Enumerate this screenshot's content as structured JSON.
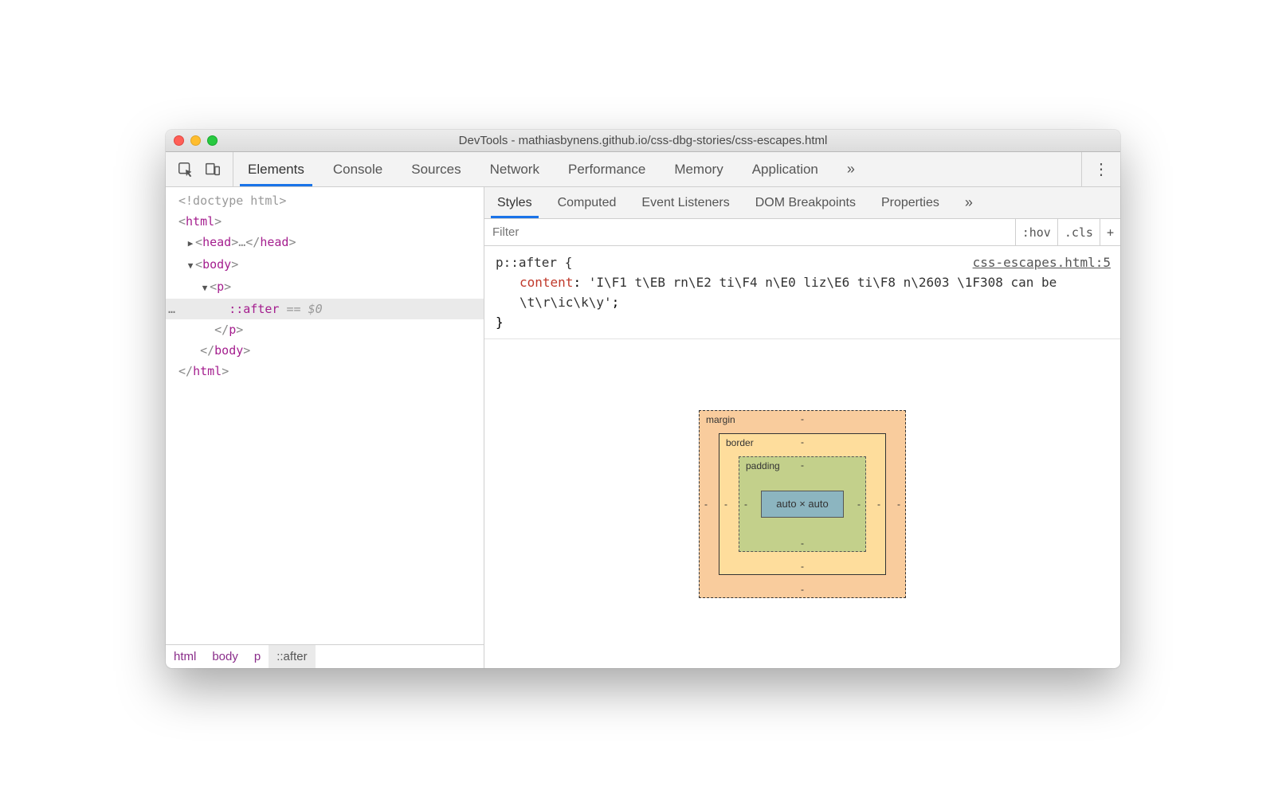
{
  "window": {
    "title": "DevTools - mathiasbynens.github.io/css-dbg-stories/css-escapes.html"
  },
  "main_tabs": {
    "items": [
      "Elements",
      "Console",
      "Sources",
      "Network",
      "Performance",
      "Memory",
      "Application"
    ],
    "overflow": "»",
    "active_index": 0
  },
  "dom": {
    "doctype": "<!doctype html>",
    "html_open": "html",
    "head_open": "head",
    "head_ellipsis": "…",
    "body_open": "body",
    "p_open": "p",
    "pseudo": "::after",
    "eq": " == ",
    "dollar": "$0",
    "p_close": "p",
    "body_close": "body",
    "html_close": "html"
  },
  "breadcrumbs": [
    "html",
    "body",
    "p",
    "::after"
  ],
  "sub_tabs": {
    "items": [
      "Styles",
      "Computed",
      "Event Listeners",
      "DOM Breakpoints",
      "Properties"
    ],
    "overflow": "»",
    "active_index": 0
  },
  "filter": {
    "placeholder": "Filter",
    "hov": ":hov",
    "cls": ".cls",
    "plus": "+"
  },
  "rule": {
    "selector": "p::after {",
    "source": "css-escapes.html:5",
    "prop": "content",
    "value": "'I\\F1 t\\EB rn\\E2 ti\\F4 n\\E0 liz\\E6 ti\\F8 n\\2603 \\1F308 can be \\t\\r\\ic\\k\\y'",
    "semi": ";",
    "close": "}"
  },
  "boxmodel": {
    "margin_label": "margin",
    "border_label": "border",
    "padding_label": "padding",
    "dash": "-",
    "content": "auto × auto"
  }
}
